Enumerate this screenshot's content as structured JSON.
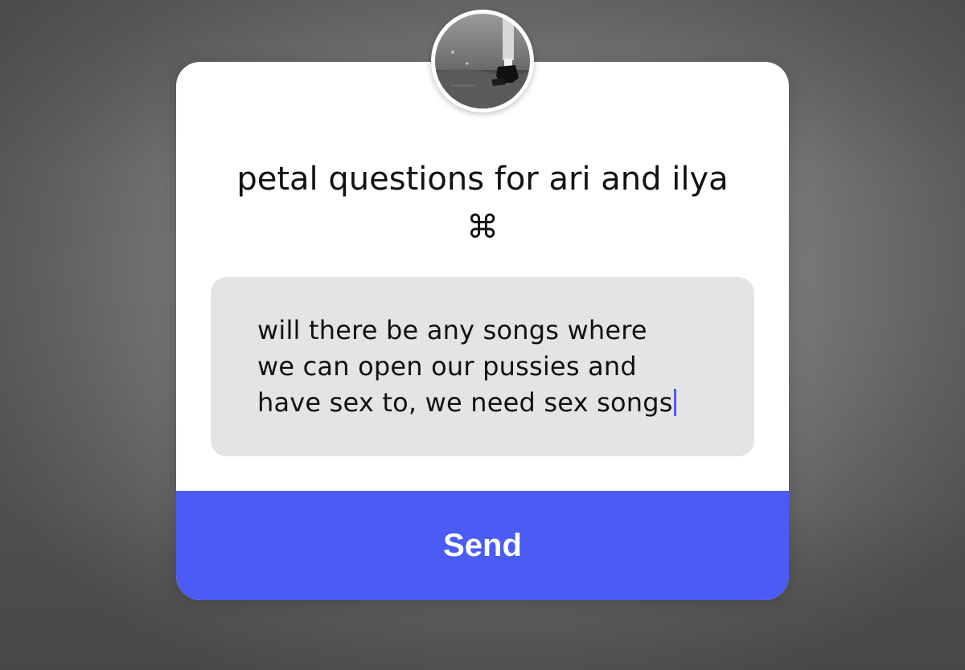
{
  "question_sticker": {
    "title": "petal questions for ari and ilya ⌘",
    "answer_text": "will there be any songs where\nwe can open our pussies and\nhave sex to, we need sex songs",
    "send_label": "Send"
  },
  "avatar": {
    "description_icon": "profile-photo-avatar"
  },
  "colors": {
    "accent": "#4a5cf3",
    "card_background": "#ffffff",
    "input_background": "#e4e4e4",
    "caret": "#4a5df2",
    "backdrop": "#7d7d7d"
  }
}
